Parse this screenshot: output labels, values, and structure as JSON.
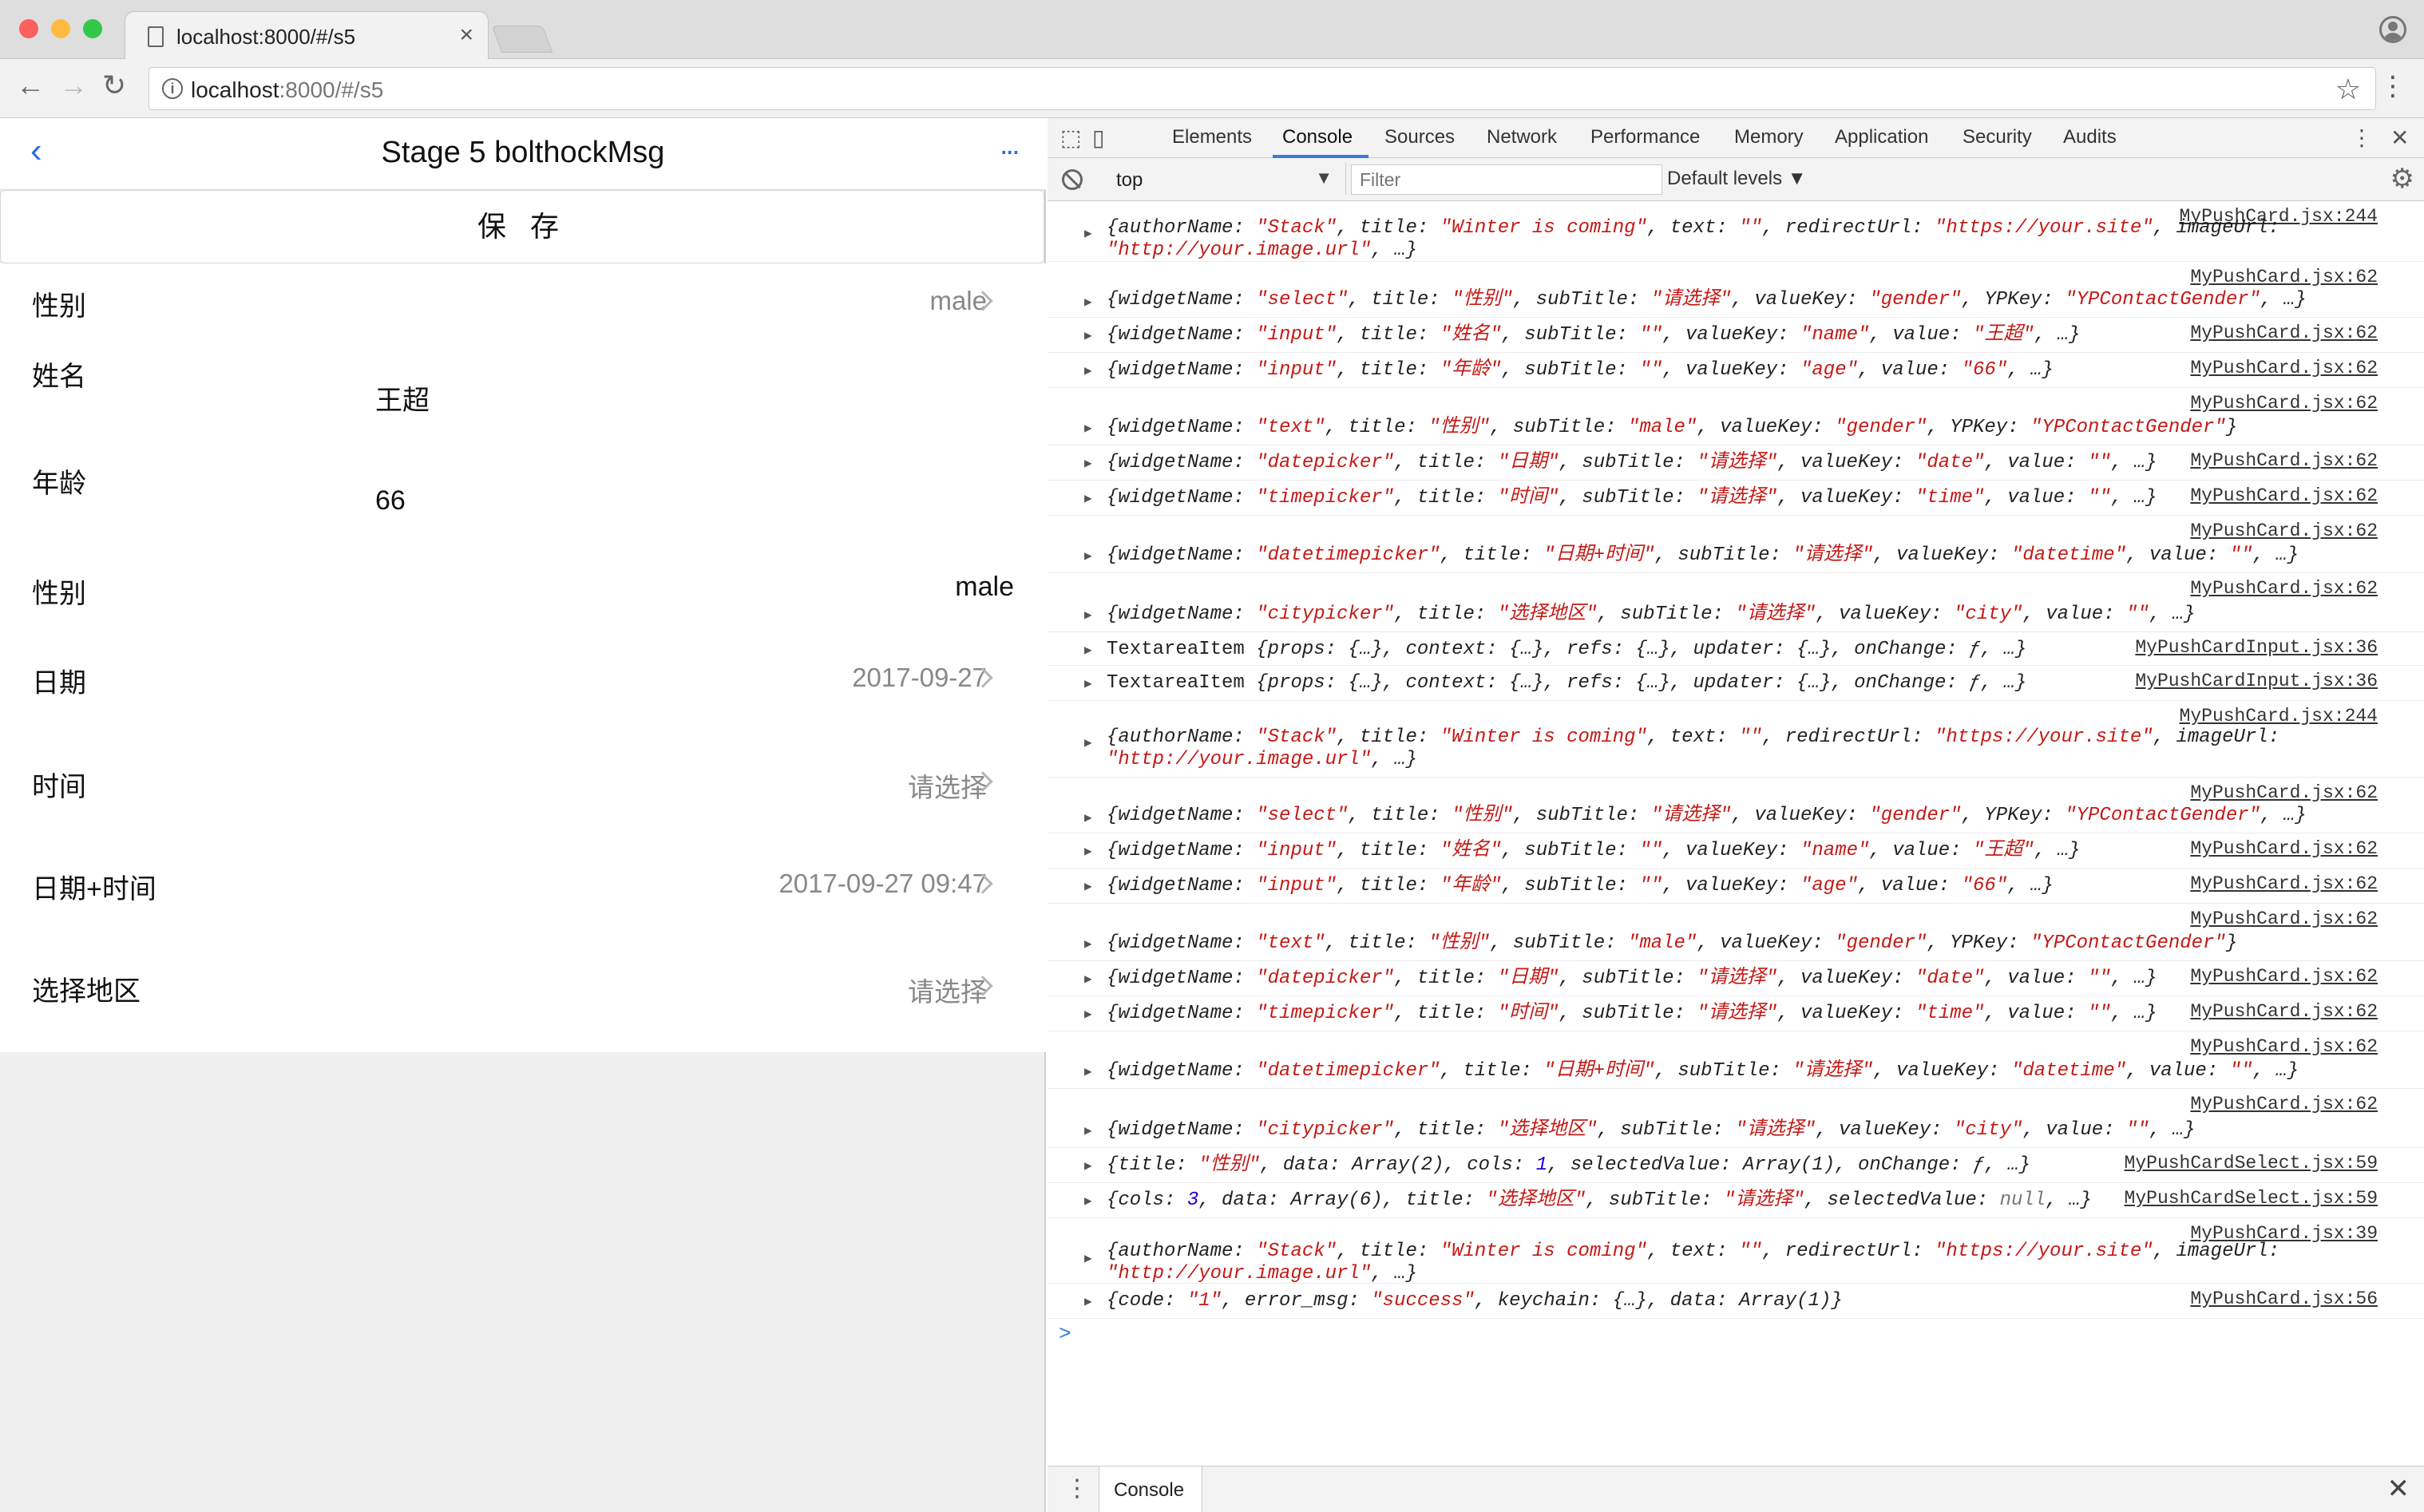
{
  "browser": {
    "tab_title": "localhost:8000/#/s5",
    "tab_close": "×",
    "url_host": "localhost",
    "url_rest": ":8000/#/s5",
    "back": "←",
    "forward": "→",
    "reload": "↻",
    "info": "i",
    "star": "☆",
    "menu": "⋮"
  },
  "app": {
    "back": "‹",
    "title": "Stage 5 bolthockMsg",
    "more": "...",
    "save_label": "保 存",
    "rows": [
      {
        "label": "性别",
        "value": "male"
      },
      {
        "label": "姓名",
        "value": "王超"
      },
      {
        "label": "年龄",
        "value": "66"
      },
      {
        "label": "性别",
        "value": "male"
      },
      {
        "label": "日期",
        "value": "2017-09-27"
      },
      {
        "label": "时间",
        "value": "请选择"
      },
      {
        "label": "日期+时间",
        "value": "2017-09-27 09:47"
      },
      {
        "label": "选择地区",
        "value": "请选择"
      }
    ]
  },
  "devtools": {
    "tabs": [
      "Elements",
      "Console",
      "Sources",
      "Network",
      "Performance",
      "Memory",
      "Application",
      "Security",
      "Audits"
    ],
    "active_tab": "Console",
    "context": "top",
    "filter_placeholder": "Filter",
    "levels": "Default levels ▼",
    "drawer_tab": "Console",
    "close": "✕",
    "kebab": "⋮",
    "messages": [
      {
        "src": "MyPushCard.jsx:244"
      },
      {
        "src": "MyPushCard.jsx:62"
      },
      {
        "src": "MyPushCard.jsx:62"
      },
      {
        "src": "MyPushCard.jsx:62"
      },
      {
        "src": "MyPushCard.jsx:62"
      },
      {
        "src": "MyPushCard.jsx:62"
      },
      {
        "src": "MyPushCard.jsx:62"
      },
      {
        "src": "MyPushCard.jsx:62"
      },
      {
        "src": "MyPushCard.jsx:62"
      },
      {
        "src": "MyPushCardInput.jsx:36"
      },
      {
        "src": "MyPushCardInput.jsx:36"
      },
      {
        "src": "MyPushCard.jsx:244"
      },
      {
        "src": "MyPushCard.jsx:62"
      },
      {
        "src": "MyPushCard.jsx:62"
      },
      {
        "src": "MyPushCard.jsx:62"
      },
      {
        "src": "MyPushCard.jsx:62"
      },
      {
        "src": "MyPushCard.jsx:62"
      },
      {
        "src": "MyPushCard.jsx:62"
      },
      {
        "src": "MyPushCard.jsx:62"
      },
      {
        "src": "MyPushCard.jsx:62"
      },
      {
        "src": "MyPushCardSelect.jsx:59"
      },
      {
        "src": "MyPushCardSelect.jsx:59"
      },
      {
        "src": "MyPushCard.jsx:39"
      },
      {
        "src": "MyPushCard.jsx:56"
      }
    ],
    "prompt": ">"
  },
  "colors": {
    "accent_blue": "#2a6ee9",
    "devtools_active": "#3879d9",
    "string_red": "#c41a16",
    "number_blue": "#1c00cf",
    "traffic_red": "#fc605c",
    "traffic_yellow": "#fdbc40",
    "traffic_green": "#34c84a"
  }
}
